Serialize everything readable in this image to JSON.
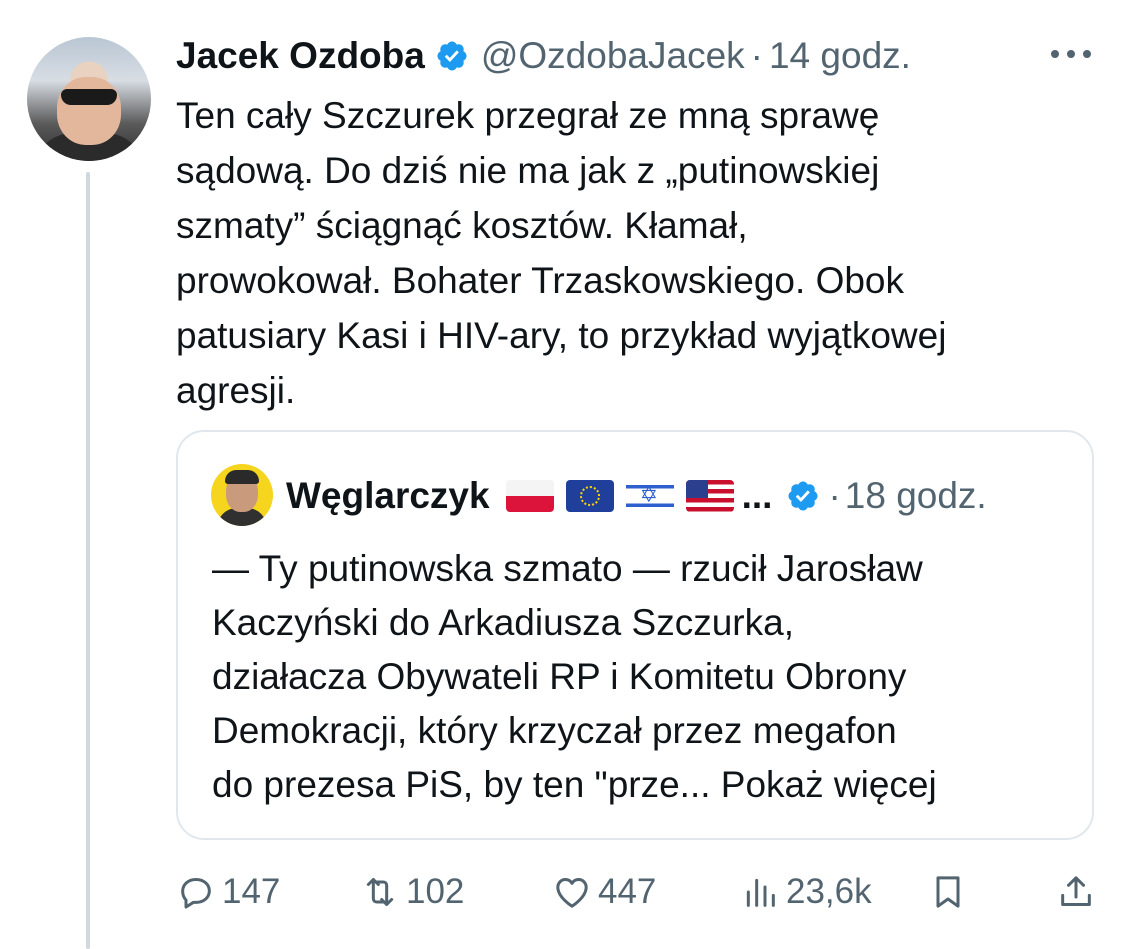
{
  "tweet": {
    "author_name": "Jacek Ozdoba",
    "handle": "@OzdobaJacek",
    "separator": "·",
    "time": "14 godz.",
    "text": "Ten cały Szczurek przegrał ze mną sprawę\nsądową. Do dziś nie ma jak z „putinowskiej\nszmaty” ściągnąć kosztów. Kłamał,\nprowokował. Bohater Trzaskowskiego. Obok\npatusiary Kasi i HIV-ary, to przykład wyjątkowej\nagresji."
  },
  "quote": {
    "author_name": "Węglarczyk",
    "flags": [
      "poland-flag",
      "eu-flag",
      "israel-flag",
      "usa-flag"
    ],
    "ellipsis": "...",
    "separator": "·",
    "time": "18 godz.",
    "text": "— Ty putinowska szmato — rzucił Jarosław\nKaczyński do Arkadiusza Szczurka,\ndziałacza Obywateli RP i Komitetu Obrony\nDemokracji, który krzyczał przez megafon\ndo prezesa PiS, by ten \"prze... Pokaż więcej"
  },
  "actions": {
    "replies": "147",
    "retweets": "102",
    "likes": "447",
    "views": "23,6k"
  },
  "colors": {
    "verified": "#1d9bf0",
    "muted": "#536471",
    "text": "#0f1419",
    "border": "#e1e8ed"
  },
  "icons": [
    "verified-badge-icon",
    "more-icon",
    "reply-icon",
    "retweet-icon",
    "like-icon",
    "views-icon",
    "bookmark-icon",
    "share-icon"
  ]
}
